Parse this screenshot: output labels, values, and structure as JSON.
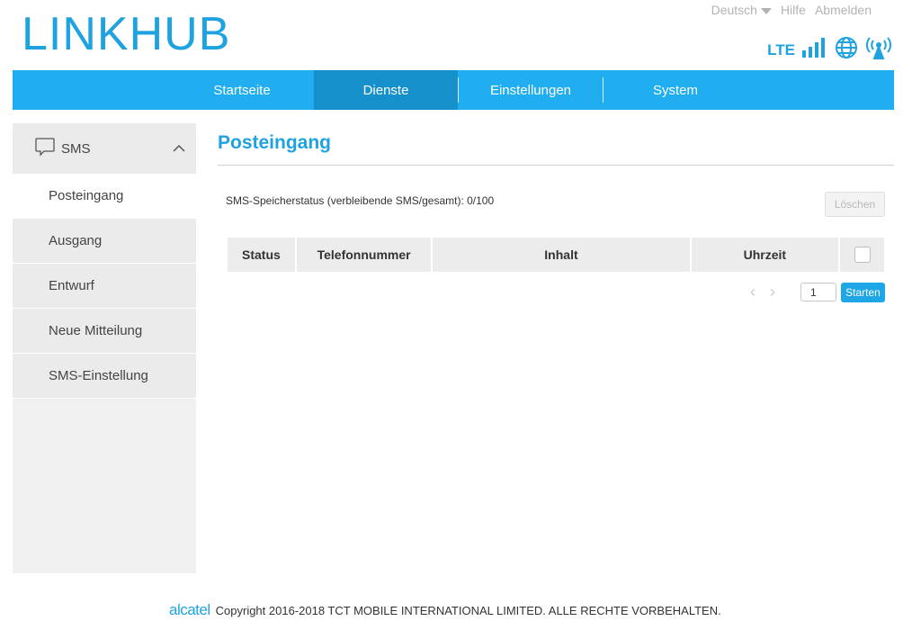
{
  "header": {
    "logo_part1": "LINK",
    "logo_part2": "HUB",
    "language": "Deutsch",
    "help": "Hilfe",
    "logout": "Abmelden",
    "network_type": "LTE",
    "accent_color": "#1fa3e0"
  },
  "nav": {
    "items": [
      {
        "label": "Startseite"
      },
      {
        "label": "Dienste",
        "active": true
      },
      {
        "label": "Einstellungen"
      },
      {
        "label": "System"
      }
    ]
  },
  "sidebar": {
    "section": "SMS",
    "items": [
      {
        "label": "Posteingang",
        "active": true
      },
      {
        "label": "Ausgang"
      },
      {
        "label": "Entwurf"
      },
      {
        "label": "Neue Mitteilung"
      },
      {
        "label": "SMS-Einstellung"
      }
    ]
  },
  "main": {
    "title": "Posteingang",
    "storage_status": "SMS-Speicherstatus (verbleibende SMS/gesamt): 0/100",
    "delete_label": "Löschen",
    "columns": [
      "Status",
      "Telefonnummer",
      "Inhalt",
      "Uhrzeit"
    ],
    "page_value": "1",
    "go_label": "Starten"
  },
  "footer": {
    "brand": "alcatel",
    "copyright": "Copyright 2016-2018 TCT MOBILE INTERNATIONAL LIMITED. ALLE RECHTE VORBEHALTEN."
  }
}
